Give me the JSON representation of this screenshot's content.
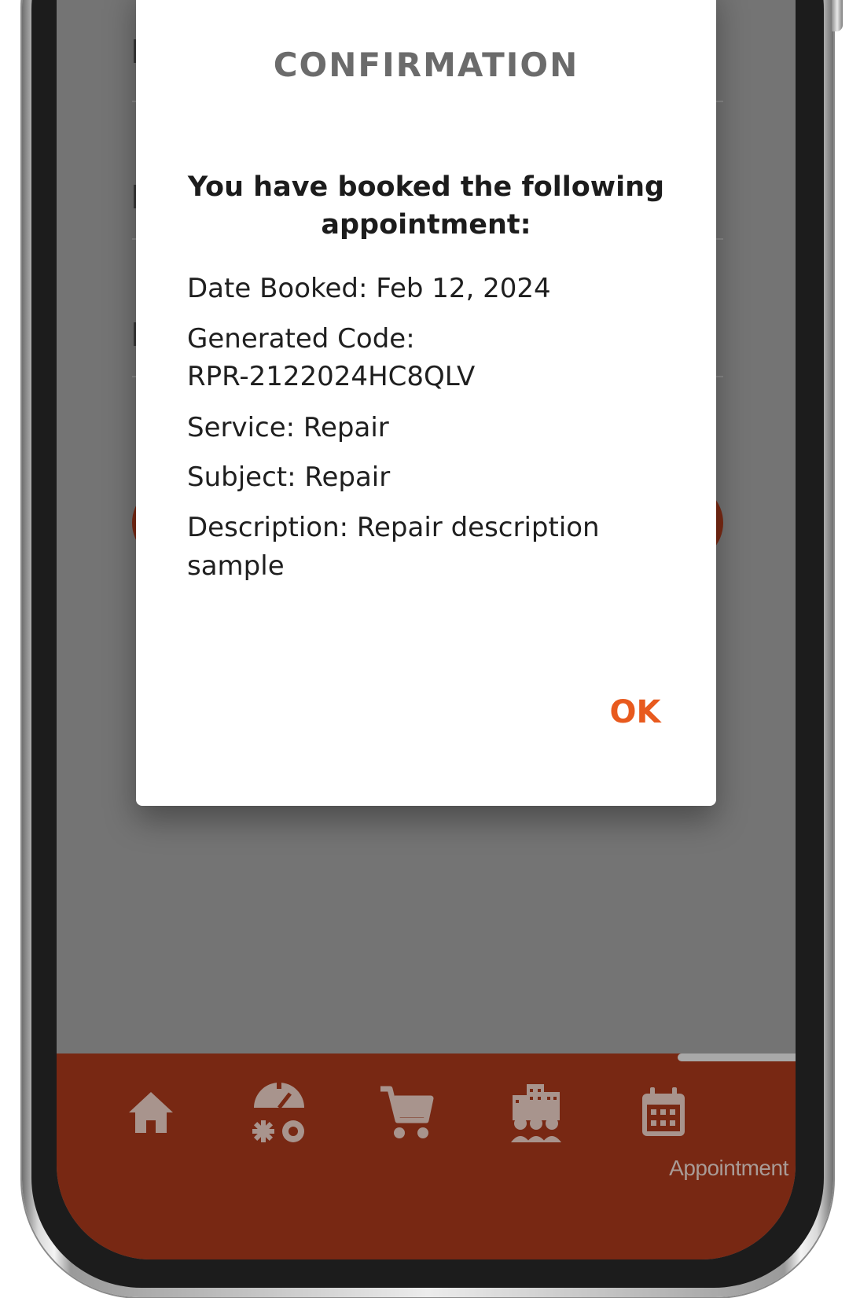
{
  "dialog": {
    "title": "CONFIRMATION",
    "heading": "You have booked the following appointment:",
    "date_booked": "Date Booked: Feb 12, 2024",
    "generated_code_label": "Generated Code:",
    "generated_code": "RPR-2122024HC8QLV",
    "service": "Service: Repair",
    "subject": "Subject: Repair",
    "description": "Description: Repair description sample",
    "ok_label": "OK"
  },
  "bottom_nav": {
    "items": [
      {
        "icon": "home-icon"
      },
      {
        "icon": "services-icon"
      },
      {
        "icon": "cart-icon"
      },
      {
        "icon": "building-people-icon"
      },
      {
        "icon": "calendar-icon",
        "label": "Appointment",
        "active": true
      }
    ]
  },
  "colors": {
    "accent": "#e85a1e",
    "nav_background": "#782813",
    "overlay": "#747474",
    "dialog_title": "#6b6b6b"
  }
}
